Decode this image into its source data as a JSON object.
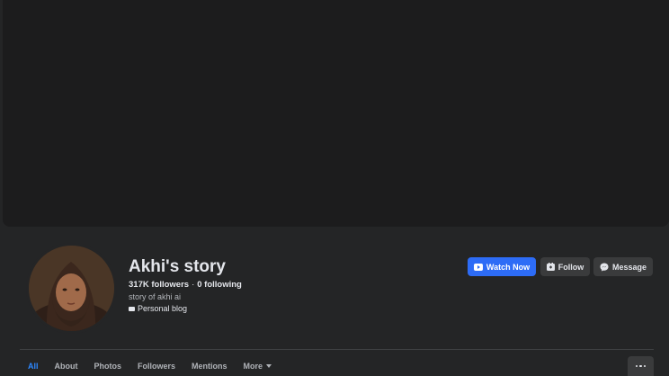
{
  "profile": {
    "name": "Akhi's story",
    "followers": "317K followers",
    "separator": "·",
    "following": "0 following",
    "bio": "story of akhi ai",
    "category": "Personal blog"
  },
  "actions": {
    "watch_label": "Watch Now",
    "follow_label": "Follow",
    "message_label": "Message"
  },
  "tabs": [
    {
      "label": "All",
      "active": true
    },
    {
      "label": "About",
      "active": false
    },
    {
      "label": "Photos",
      "active": false
    },
    {
      "label": "Followers",
      "active": false
    },
    {
      "label": "Mentions",
      "active": false
    },
    {
      "label": "More",
      "active": false
    }
  ],
  "icons": {
    "watch": "play-video-icon",
    "follow": "follow-icon",
    "message": "messenger-icon",
    "category": "briefcase-icon",
    "more_caret": "caret-down-icon",
    "overflow": "ellipsis-icon"
  },
  "colors": {
    "background": "#242526",
    "cover": "#1c1c1d",
    "primary_button": "#2d6cf6",
    "secondary_button": "#3a3b3c",
    "active_tab": "#2d88ff"
  }
}
